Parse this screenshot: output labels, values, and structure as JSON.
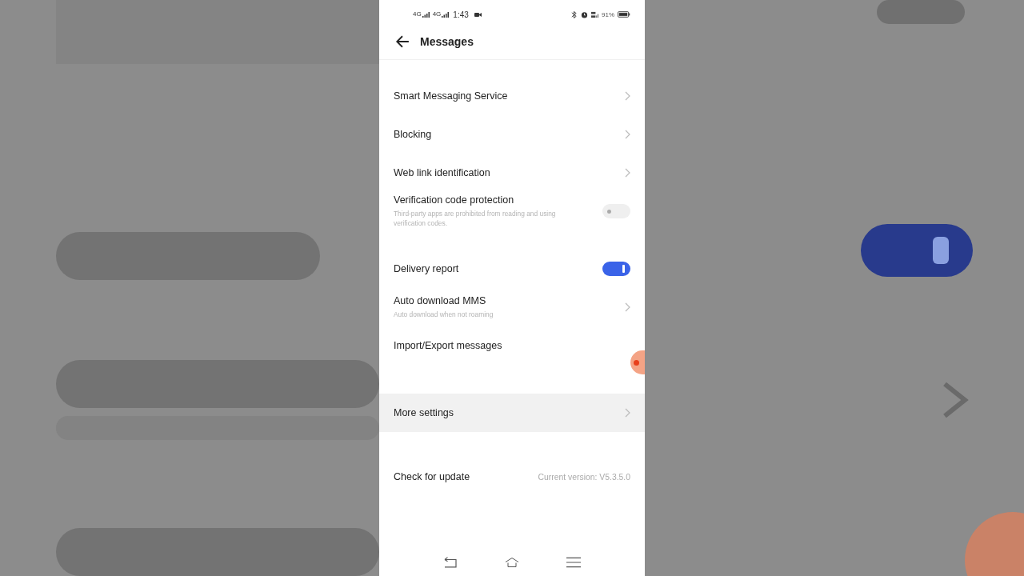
{
  "status_bar": {
    "signal_left": [
      "4G",
      "4G"
    ],
    "time": "1:43",
    "battery": "91%"
  },
  "header": {
    "title": "Messages"
  },
  "groups": [
    {
      "items": [
        {
          "kind": "link",
          "label": "Smart Messaging Service",
          "pressed": false
        },
        {
          "kind": "link",
          "label": "Blocking",
          "pressed": false
        },
        {
          "kind": "link",
          "label": "Web link identification",
          "pressed": false
        },
        {
          "kind": "toggle",
          "label": "Verification code protection",
          "description": "Third-party apps are prohibited from reading and using verification codes.",
          "on": false,
          "pressed": false
        }
      ]
    },
    {
      "items": [
        {
          "kind": "toggle",
          "label": "Delivery report",
          "on": true,
          "pressed": false
        },
        {
          "kind": "link",
          "label": "Auto download MMS",
          "description": "Auto download when not roaming",
          "pressed": false
        },
        {
          "kind": "plain",
          "label": "Import/Export messages",
          "pressed": false
        }
      ]
    },
    {
      "items": [
        {
          "kind": "link",
          "label": "More settings",
          "pressed": true
        }
      ]
    },
    {
      "items": [
        {
          "kind": "value",
          "label": "Check for update",
          "value": "Current version: V5.3.5.0",
          "pressed": false
        }
      ]
    }
  ]
}
